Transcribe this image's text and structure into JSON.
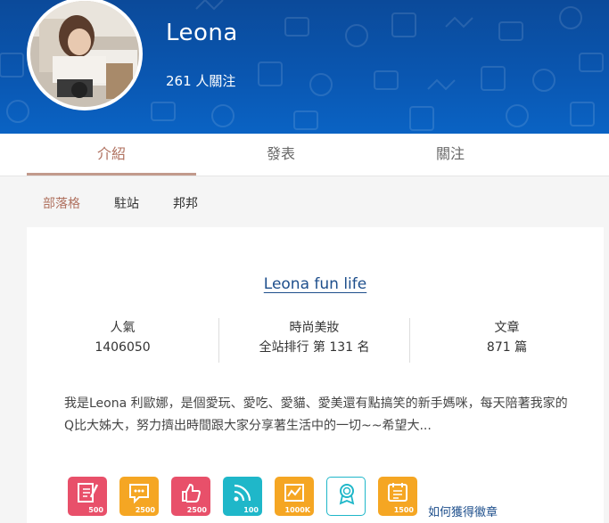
{
  "header": {
    "user_name": "Leona",
    "follow_count": "261 人關注"
  },
  "tabs": [
    {
      "label": "介紹",
      "active": true
    },
    {
      "label": "發表",
      "active": false
    },
    {
      "label": "關注",
      "active": false
    }
  ],
  "subnav": [
    {
      "label": "部落格",
      "active": true
    },
    {
      "label": "駐站",
      "active": false
    },
    {
      "label": "邦邦",
      "active": false
    }
  ],
  "blog": {
    "title": "Leona fun life",
    "stats": [
      {
        "label": "人氣",
        "value": "1406050"
      },
      {
        "label": "時尚美妝",
        "value": "全站排行 第 131 名"
      },
      {
        "label": "文章",
        "value": "871 篇"
      }
    ],
    "bio": "我是Leona 利歐娜，是個愛玩、愛吃、愛貓、愛美還有點搞笑的新手媽咪，每天陪著我家的Q比大姊大，努力擠出時間跟大家分享著生活中的一切~~希望大..."
  },
  "badges": [
    {
      "icon": "edit-icon",
      "count": "500",
      "color": "#e8506a"
    },
    {
      "icon": "chat-icon",
      "count": "2500",
      "color": "#f5a623"
    },
    {
      "icon": "thumbs-up-icon",
      "count": "2500",
      "color": "#e8506a"
    },
    {
      "icon": "rss-icon",
      "count": "100",
      "color": "#1fb7c9"
    },
    {
      "icon": "chart-icon",
      "count": "1000K",
      "color": "#f5a623"
    },
    {
      "icon": "award-icon",
      "count": "",
      "color": "#1fb7c9"
    },
    {
      "icon": "pimple-icon",
      "count": "1500",
      "color": "#f5a623"
    }
  ],
  "how_to_get_badges": "如何獲得徽章"
}
